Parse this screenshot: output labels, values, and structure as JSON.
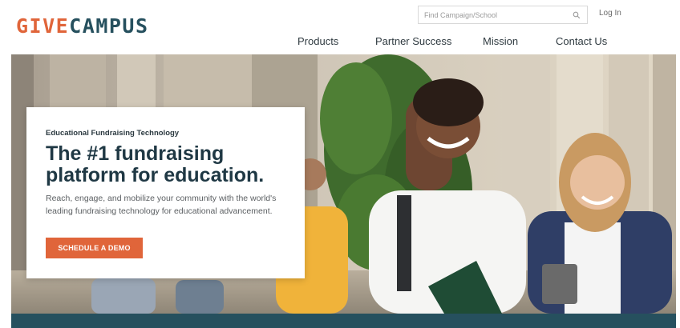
{
  "brand": {
    "logo_part1": "GIVE",
    "logo_part2": "CAMPUS",
    "accent_color": "#e0653a",
    "primary_color": "#26505e"
  },
  "header": {
    "search": {
      "placeholder": "Find Campaign/School",
      "value": "",
      "icon": "search-icon"
    },
    "login_label": "Log In"
  },
  "nav": {
    "items": [
      {
        "label": "Products"
      },
      {
        "label": "Partner Success"
      },
      {
        "label": "Mission"
      },
      {
        "label": "Contact Us"
      }
    ]
  },
  "hero": {
    "eyebrow": "Educational Fundraising Technology",
    "headline": "The #1 fundraising platform for education.",
    "description": "Reach, engage, and mobilize your community with the world's leading fundraising technology for educational advancement.",
    "cta_label": "SCHEDULE A DEMO"
  }
}
